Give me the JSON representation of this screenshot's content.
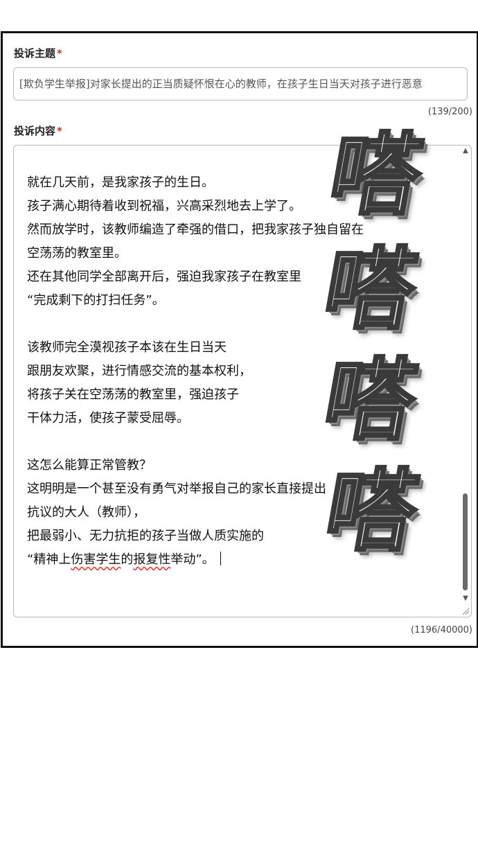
{
  "subject": {
    "label": "投诉主题",
    "required_mark": "*",
    "value": "[欺负学生举报]对家长提出的正当质疑怀恨在心的教师，在孩子生日当天对孩子进行恶意",
    "counter": "(139/200)"
  },
  "content": {
    "label": "投诉内容",
    "required_mark": "*",
    "lines": [
      "就在几天前，是我家孩子的生日。",
      "孩子满心期待着收到祝福，兴高采烈地去上学了。",
      "然而放学时，该教师编造了牵强的借口，把我家孩子独自留在",
      "空荡荡的教室里。",
      "还在其他同学全部离开后，强迫我家孩子在教室里",
      "“完成剩下的打扫任务”。",
      "",
      "该教师完全漠视孩子本该在生日当天",
      "跟朋友欢聚，进行情感交流的基本权利，",
      "将孩子关在空荡荡的教室里，强迫孩子",
      "干体力活，使孩子蒙受屈辱。",
      "",
      "这怎么能算正常管教？",
      "这明明是一个甚至没有勇气对举报自己的家长直接提出",
      "抗议的大人（教师），",
      "把最弱小、无力抗拒的孩子当做人质实施的"
    ],
    "last_line_prefix": "“精神上",
    "last_line_misspelled": "伤害学生",
    "last_line_mid": "的",
    "last_line_misspelled2": "报复性",
    "last_line_suffix": "举动”。",
    "counter": "(1196/40000)"
  },
  "sound_effects": [
    "嗒",
    "嗒",
    "嗒",
    "嗒"
  ],
  "colors": {
    "required_mark": "#c0392b",
    "border": "#111111",
    "input_border": "#b8b8b8"
  }
}
